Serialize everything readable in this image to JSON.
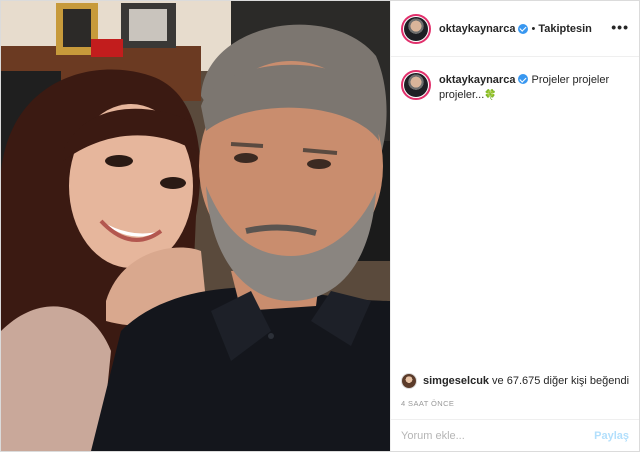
{
  "post": {
    "author": "oktaykaynarca",
    "follow_status": "Takiptesin",
    "separator": "•",
    "more_icon": "•••",
    "caption": "Projeler projeler projeler...",
    "caption_emoji": "🍀",
    "liked_by_user": "simgeselcuk",
    "liked_by_rest": "ve 67.675 diğer kişi beğendi",
    "timestamp": "4 SAAT ÖNCE",
    "comment_placeholder": "Yorum ekle...",
    "post_button": "Paylaş"
  },
  "colors": {
    "verified_badge": "#3897f0",
    "story_ring": "#e1306c",
    "post_button_disabled": "#b2dffc"
  }
}
